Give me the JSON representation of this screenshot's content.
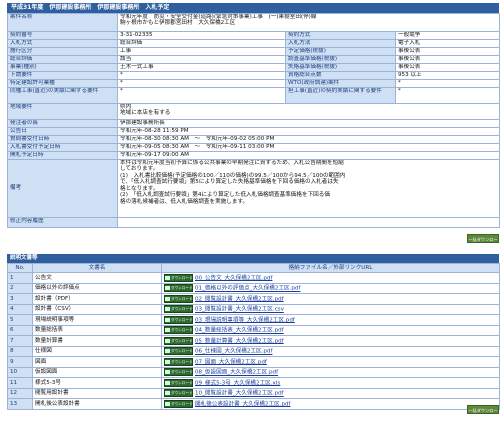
{
  "header": {
    "title": "平成31年度　伊那建設事務所　伊那建設事務所　入札予定"
  },
  "info": {
    "project_name_label": "案件名称",
    "project_name_line1": "令和元年度　防災・安全交付金(道路)(緊急対策事業)工事　(一)果樹室田(停)線",
    "project_name_line2": "駒ヶ根市かもと伊那郡宮田村　大久保橋2工区",
    "contract_no_label": "契約番号",
    "contract_no": "3-31-02335",
    "contract_method_label": "契約方式",
    "contract_method": "一般競争",
    "bid_method_label": "入札方式",
    "bid_method": "総合評価",
    "bid_format_label": "入札方法",
    "bid_format": "電子入札",
    "construction_type_label": "施行区分",
    "construction_type": "工事",
    "estimate_label": "予定価格(税抜)",
    "estimate": "事後公表",
    "evaluation_label": "総合評価",
    "evaluation": "該当",
    "survey_price_label": "調査基準価格(税抜)",
    "survey_price": "事後公表",
    "business_type_label": "事業(種別)",
    "business_type": "土木一式工事",
    "lowest_price_label": "失格基準価格(税抜)",
    "lowest_price": "事後公表",
    "subcontract_label": "下請要件",
    "subcontract": "*",
    "score_label": "資格総合点数",
    "score": "953 以上",
    "special_label": "特定建設許可業種",
    "special": "*",
    "wto_label": "WTO(政府調達)案件",
    "wto": "*",
    "jv_label": "同種工事(直近)の実績に関する要件",
    "jv": "*",
    "engineer_label": "担工事(直近)の契約実績に関する要件",
    "engineer": "*",
    "region_label": "地域要件",
    "region_line1": "県内",
    "region_line2": "地域に本店を有する",
    "office_label": "発注者の長",
    "office": "伊那建設事務所長",
    "publish_label": "公告日",
    "publish": "令和元年-08-28 11:59 PM",
    "question_label": "質問書受付日時",
    "question": "令和元年-08-30 08:30 AM　～　令和元年-09-02 05:00 PM",
    "bid_receive_label": "入札書受付予定日時",
    "bid_receive": "令和元年-09-05 08:30 AM　～　令和元年-09-11 03:00 PM",
    "open_label": "開札予定日時",
    "open": "令和元年-09-17 09:00 AM",
    "notes_label": "備考",
    "notes_lines": [
      "本件は令和元年度当初予算に係る公共事業の早期発注に資するため、入札公告期間を短縮",
      "しております。",
      "(1)　入札書比較価格(予定価格の100／110の価格)の99.5／100から94.5／100の範囲内",
      "で、「低入札調査試行要領」第5により算定した失格基準価格を下回る価格の入札者は失",
      "格となります。",
      "(2)　「低入札調査試行要領」第4により算定した低入札価格調査基準価格を下回る価",
      "格の落札候補者は、低入札価格調査を実施します。"
    ],
    "history_label": "修正内容履歴",
    "history": ""
  },
  "pdf_button_label": "一括ダウンロード",
  "documents": {
    "title": "説明文書等",
    "col_no": "No.",
    "col_name": "文書名",
    "col_file": "格納ファイル名／外部リンクURL",
    "download_label": "ダウンロード",
    "rows": [
      {
        "no": "1",
        "name": "公告文",
        "file": "00_公告文_大久保橋2工区.pdf"
      },
      {
        "no": "2",
        "name": "価格以外の評価点",
        "file": "01_価格以外の評価点_大久保橋2工区.pdf"
      },
      {
        "no": "3",
        "name": "設計書（PDF）",
        "file": "02_閲覧設計書_大久保橋2工区.pdf"
      },
      {
        "no": "4",
        "name": "設計書（CSV）",
        "file": "03_閲覧設計書_大久保橋2工区.csv"
      },
      {
        "no": "5",
        "name": "現場説明事項等",
        "file": "03_現場説明事項等_大久保橋2工区.pdf"
      },
      {
        "no": "6",
        "name": "数量総括表",
        "file": "04_数量総括表_大久保橋2工区.pdf"
      },
      {
        "no": "7",
        "name": "数量計算書",
        "file": "05_数量計算書_大久保橋2工区.pdf"
      },
      {
        "no": "8",
        "name": "仕様図",
        "file": "06_仕様図_大久保橋2工区.pdf"
      },
      {
        "no": "9",
        "name": "図面",
        "file": "07_図面_大久保橋2工区.pdf"
      },
      {
        "no": "10",
        "name": "仮設図面",
        "file": "08_仮設図面_大久保橋2工区.pdf"
      },
      {
        "no": "11",
        "name": "様式5-3号",
        "file": "09_様式5-3号_大久保橋2工区.xls"
      },
      {
        "no": "12",
        "name": "閲覧用設計書",
        "file": "10_閲覧設計書_大久保橋2工区.pdf"
      },
      {
        "no": "13",
        "name": "開札後公表設計書",
        "file": "開札後公表設計書_大久保橋2工区.pdf"
      }
    ]
  }
}
